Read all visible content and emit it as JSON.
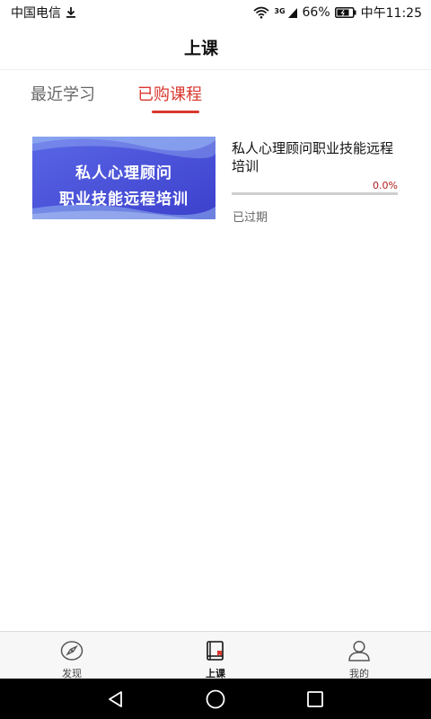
{
  "status_bar": {
    "carrier": "中国电信",
    "network": "3G",
    "battery": "66%",
    "time": "中午11:25",
    "icons": [
      "download-icon",
      "wifi-icon",
      "signal-icon",
      "battery-icon"
    ]
  },
  "header": {
    "title": "上课"
  },
  "tabs": [
    {
      "label": "最近学习",
      "active": false
    },
    {
      "label": "已购课程",
      "active": true
    }
  ],
  "course": {
    "cover_line_1": "私人心理顾问",
    "cover_line_2": "职业技能远程培训",
    "title": "私人心理顾问职业技能远程培训",
    "progress_label": "0.0%",
    "progress_value": 0.0,
    "status": "已过期"
  },
  "bottom_nav": [
    {
      "label": "发现",
      "icon": "compass-icon",
      "active": false
    },
    {
      "label": "上课",
      "icon": "book-icon",
      "active": true
    },
    {
      "label": "我的",
      "icon": "profile-icon",
      "active": false
    }
  ],
  "system_nav": {
    "icons": [
      "back-icon",
      "home-icon",
      "recents-icon"
    ]
  },
  "colors": {
    "accent": "#d9372e",
    "cover_blue": "#4a4fd8",
    "progress_text": "#b01c1c"
  }
}
